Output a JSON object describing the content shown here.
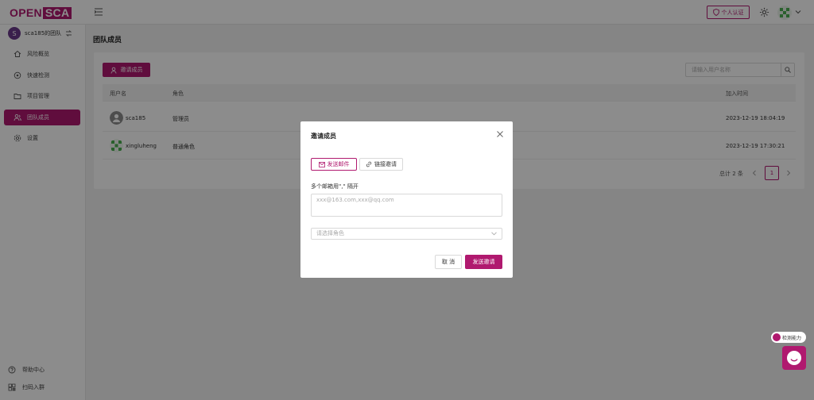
{
  "brand": {
    "logo_part1": "OPEN",
    "logo_part2": "SCA"
  },
  "header": {
    "cert_label": "个人认证",
    "accent": "#b0196f"
  },
  "sidebar": {
    "team_initial": "S",
    "team_name": "sca185的团队",
    "items": [
      {
        "label": "风险概览",
        "icon": "home-icon"
      },
      {
        "label": "快速检测",
        "icon": "scan-icon"
      },
      {
        "label": "项目管理",
        "icon": "folder-icon"
      },
      {
        "label": "团队成员",
        "icon": "team-icon",
        "active": true
      },
      {
        "label": "设置",
        "icon": "gear-icon"
      }
    ],
    "bottom": [
      {
        "label": "帮助中心",
        "icon": "help-icon"
      },
      {
        "label": "扫码入群",
        "icon": "qrcode-icon"
      }
    ]
  },
  "page": {
    "title": "团队成员",
    "invite_button": "邀请成员",
    "search_placeholder": "请输入用户名称"
  },
  "table": {
    "columns": [
      "用户名",
      "角色",
      "加入时间"
    ],
    "rows": [
      {
        "username": "sca185",
        "role": "管理员",
        "joined": "2023-12-19 18:04:19",
        "avatar": "default-user-avatar"
      },
      {
        "username": "xingluheng",
        "role": "普通角色",
        "joined": "2023-12-19 17:30:21",
        "avatar": "identicon-avatar"
      }
    ]
  },
  "pagination": {
    "total_text": "总计 2 条",
    "current_page": "1"
  },
  "modal": {
    "title": "邀请成员",
    "tab_email": "发送邮件",
    "tab_link": "链接邀请",
    "emails_label": "多个邮箱用\",\" 隔开",
    "emails_placeholder": "xxx@163.com,xxx@qq.com",
    "role_placeholder": "请选择角色",
    "cancel_label": "取 消",
    "send_label": "发送邀请"
  },
  "floating": {
    "badge_label": "检测能力"
  }
}
